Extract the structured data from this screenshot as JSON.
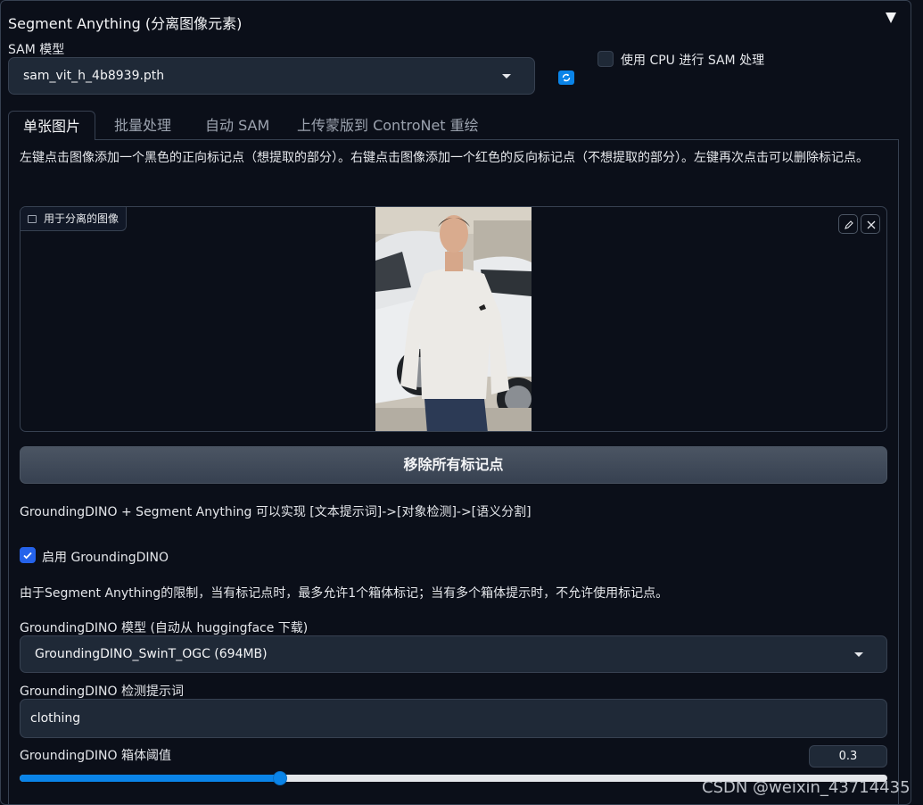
{
  "section": {
    "title": "Segment Anything (分离图像元素)"
  },
  "sam": {
    "model_label": "SAM 模型",
    "model_value": "sam_vit_h_4b8939.pth",
    "cpu_label": "使用 CPU 进行 SAM 处理",
    "cpu_checked": false
  },
  "tabs": [
    {
      "label": "单张图片",
      "active": true
    },
    {
      "label": "批量处理",
      "active": false
    },
    {
      "label": "自动 SAM",
      "active": false
    },
    {
      "label": "上传蒙版到 ControNet 重绘",
      "active": false
    }
  ],
  "single": {
    "instructions": "左键点击图像添加一个黑色的正向标记点（想提取的部分）。右键点击图像添加一个红色的反向标记点（不想提取的部分）。左键再次点击可以删除标记点。",
    "image_label": "用于分离的图像",
    "remove_points_button": "移除所有标记点",
    "grounding_intro": "GroundingDINO + Segment Anything 可以实现 [文本提示词]->[对象检测]->[语义分割]",
    "enable_label": "启用 GroundingDINO",
    "enable_checked": true,
    "limit_note": "由于Segment Anything的限制，当有标记点时，最多允许1个箱体标记；当有多个箱体提示时，不允许使用标记点。",
    "dino_model_label": "GroundingDINO 模型 (自动从 huggingface 下载)",
    "dino_model_value": "GroundingDINO_SwinT_OGC (694MB)",
    "prompt_label": "GroundingDINO 检测提示词",
    "prompt_value": "clothing",
    "threshold_label": "GroundingDINO 箱体阈值",
    "threshold_value": "0.3",
    "threshold_fraction": 0.3
  },
  "watermark": "CSDN @weixin_43714435",
  "colors": {
    "accent": "#0a84e8",
    "background": "#0b0f19",
    "panel": "#1f2937",
    "border": "#374151"
  }
}
